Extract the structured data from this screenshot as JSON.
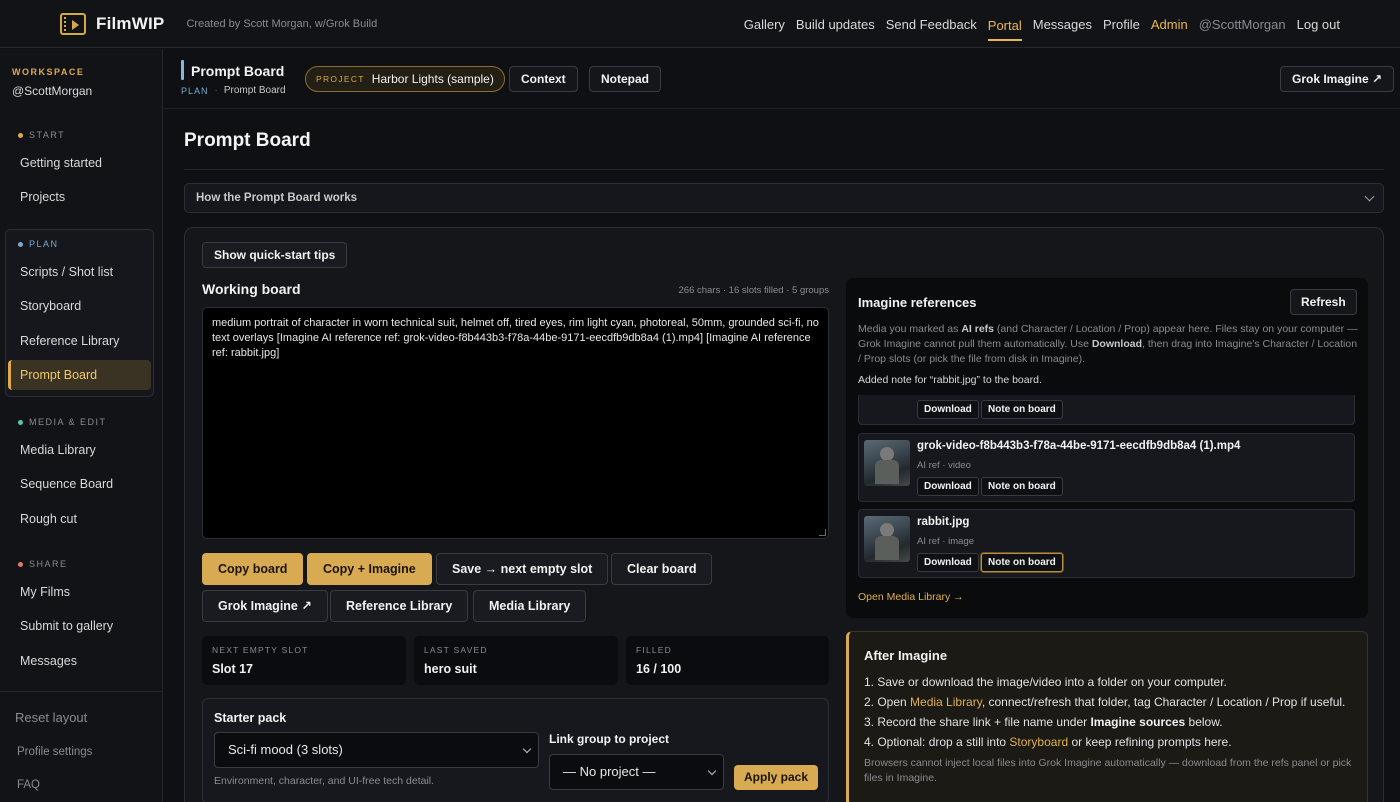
{
  "brand": {
    "name": "FilmWIP",
    "credit": "Created by Scott Morgan, w/Grok Build"
  },
  "nav": {
    "gallery": "Gallery",
    "build_updates": "Build updates",
    "send_feedback": "Send Feedback",
    "portal": "Portal",
    "messages": "Messages",
    "profile": "Profile",
    "admin": "Admin",
    "user": "@ScottMorgan",
    "logout": "Log out"
  },
  "sidebar": {
    "workspace_label": "WORKSPACE",
    "workspace_user": "@ScottMorgan",
    "sections": {
      "start": {
        "label": "START",
        "color": "#e0a94a",
        "items": [
          "Getting started",
          "Projects"
        ]
      },
      "plan": {
        "label": "PLAN",
        "color": "#7aa8d0",
        "items": [
          "Scripts / Shot list",
          "Storyboard",
          "Reference Library",
          "Prompt Board"
        ]
      },
      "media": {
        "label": "MEDIA & EDIT",
        "color": "#5cc8a0",
        "items": [
          "Media Library",
          "Sequence Board",
          "Rough cut"
        ]
      },
      "share": {
        "label": "SHARE",
        "color": "#e07a6a",
        "items": [
          "My Films",
          "Submit to gallery",
          "Messages"
        ]
      }
    },
    "footer": {
      "reset": "Reset layout",
      "profile_settings": "Profile settings",
      "faq": "FAQ"
    }
  },
  "header": {
    "title": "Prompt Board",
    "crumb_section": "PLAN",
    "crumb_sep": "·",
    "crumb_page": "Prompt Board",
    "project_key": "PROJECT",
    "project_name": "Harbor Lights (sample)",
    "context": "Context",
    "notepad": "Notepad",
    "grok": "Grok Imagine ↗"
  },
  "main": {
    "title": "Prompt Board",
    "accordion": "How the Prompt Board works",
    "quickstart": "Show quick-start tips",
    "working_board": {
      "title": "Working board",
      "meta": "266 chars · 16 slots filled · 5 groups",
      "text": "medium portrait of character in worn technical suit, helmet off, tired eyes, rim light cyan, photoreal, 50mm, grounded sci-fi, no text overlays [Imagine AI reference ref: grok-video-f8b443b3-f78a-44be-9171-eecdfb9db8a4 (1).mp4] [Imagine AI reference ref: rabbit.jpg]"
    },
    "actions": {
      "copy_board": "Copy board",
      "copy_imagine": "Copy + Imagine",
      "save_next": "Save → next empty slot",
      "clear": "Clear board",
      "grok": "Grok Imagine ↗",
      "ref_lib": "Reference Library",
      "media_lib": "Media Library"
    },
    "stats": {
      "next_label": "NEXT EMPTY SLOT",
      "next_value": "Slot 17",
      "saved_label": "LAST SAVED",
      "saved_value": "hero suit",
      "filled_label": "FILLED",
      "filled_value": "16 / 100"
    },
    "starter": {
      "title": "Starter pack",
      "selected": "Sci-fi mood (3 slots)",
      "hint": "Environment, character, and UI-free tech detail.",
      "link_label": "Link group to project",
      "project_selected": "— No project —",
      "apply": "Apply pack"
    }
  },
  "refs": {
    "title": "Imagine references",
    "refresh": "Refresh",
    "desc_1": "Media you marked as ",
    "desc_b1": "AI refs",
    "desc_2": " (and Character / Location / Prop) appear here. Files stay on your computer — Grok Imagine cannot pull them automatically. Use ",
    "desc_b2": "Download",
    "desc_3": ", then drag into Imagine's Character / Location / Prop slots (or pick the file from disk in Imagine).",
    "note": "Added note for “rabbit.jpg” to the board.",
    "download": "Download",
    "note_on_board": "Note on board",
    "items": [
      {
        "name": "grok-video-f8b443b3-f78a-44be-9171-eecdfb9db8a4 (1).mp4",
        "sub": "AI ref · video"
      },
      {
        "name": "rabbit.jpg",
        "sub": "AI ref · image"
      }
    ],
    "open_media": "Open Media Library →"
  },
  "after": {
    "title": "After Imagine",
    "s1": "1. Save or download the image/video into a folder on your computer.",
    "s2_a": "2. Open ",
    "s2_link": "Media Library",
    "s2_b": ", connect/refresh that folder, tag Character / Location / Prop if useful.",
    "s3_a": "3. Record the share link + file name under ",
    "s3_b": "Imagine sources",
    "s3_c": " below.",
    "s4_a": "4. Optional: drop a still into ",
    "s4_link": "Storyboard",
    "s4_b": " or keep refining prompts here.",
    "footnote": "Browsers cannot inject local files into Grok Imagine automatically — download from the refs panel or pick files in Imagine."
  }
}
